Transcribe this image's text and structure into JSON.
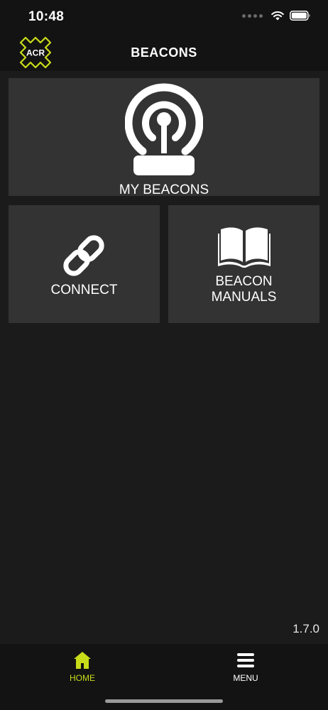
{
  "status_bar": {
    "time": "10:48"
  },
  "header": {
    "logo_text": "ACR",
    "title": "BEACONS"
  },
  "tiles": [
    {
      "label": "MY BEACONS",
      "icon": "beacon-signal-icon"
    },
    {
      "label": "CONNECT",
      "icon": "link-icon"
    },
    {
      "label_line1": "BEACON",
      "label_line2": "MANUALS",
      "icon": "book-icon"
    }
  ],
  "version": "1.7.0",
  "tab_bar": {
    "home_label": "HOME",
    "menu_label": "MENU",
    "active_color": "#c9dc1a",
    "inactive_color": "#ffffff"
  },
  "colors": {
    "background": "#1b1b1b",
    "bar": "#131313",
    "tile": "#333333",
    "accent": "#c9dc1a"
  }
}
